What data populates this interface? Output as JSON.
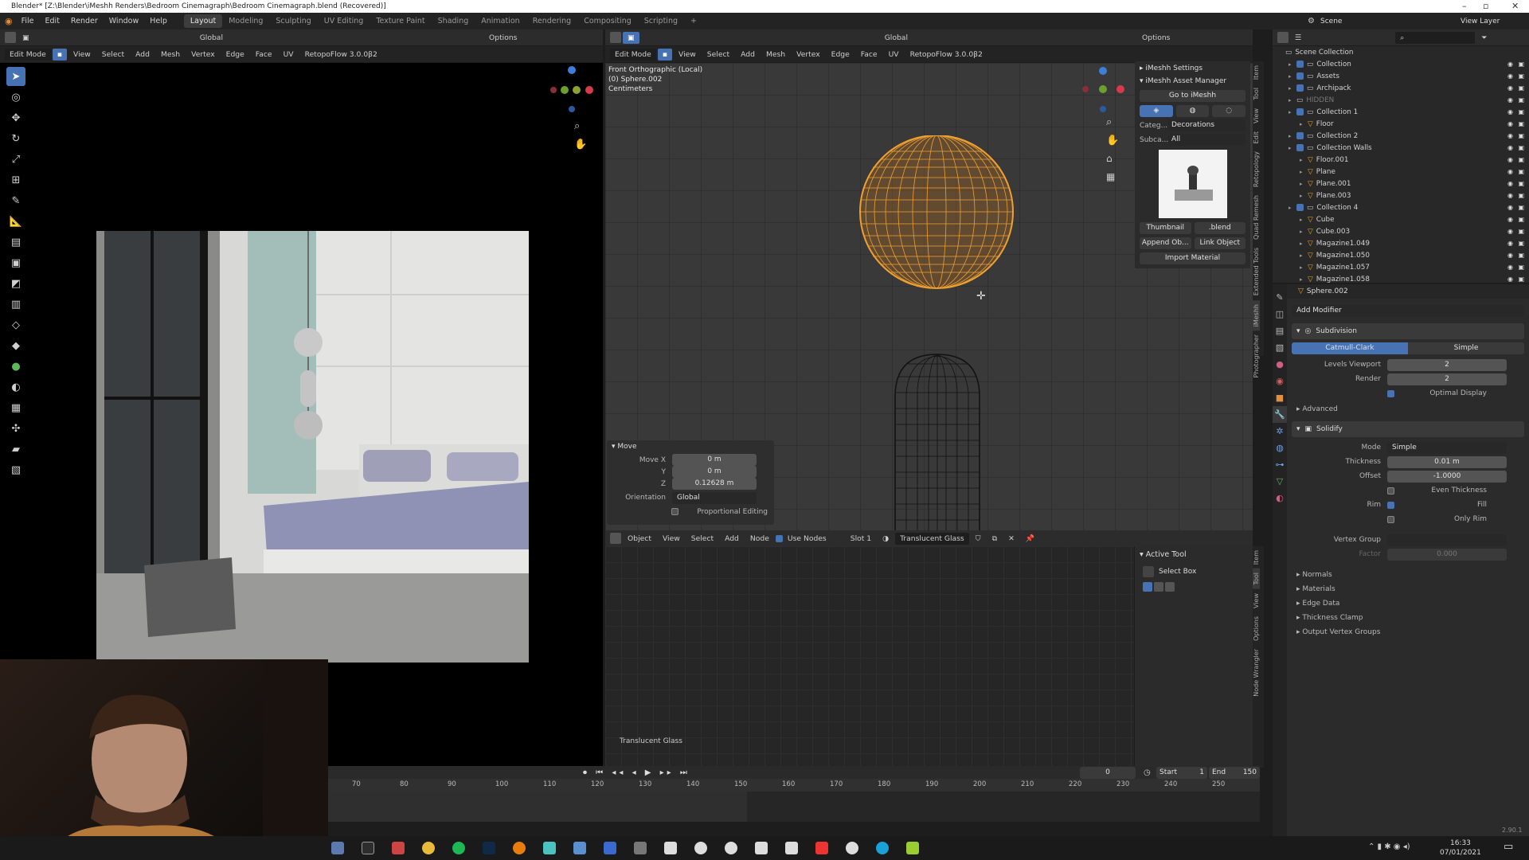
{
  "window": {
    "title": "Blender* [Z:\\Blender\\iMeshh Renders\\Bedroom Cinemagraph\\Bedroom Cinemagraph.blend (Recovered)]"
  },
  "menu": [
    "File",
    "Edit",
    "Render",
    "Window",
    "Help"
  ],
  "workspaces": [
    "Layout",
    "Modeling",
    "Sculpting",
    "UV Editing",
    "Texture Paint",
    "Shading",
    "Animation",
    "Rendering",
    "Compositing",
    "Scripting",
    "+"
  ],
  "scene": {
    "label": "Scene",
    "view_layer": "View Layer"
  },
  "left_view": {
    "header1": {
      "orientation": "Global",
      "options": "Options"
    },
    "header2": {
      "mode": "Edit Mode",
      "menus": [
        "View",
        "Select",
        "Add",
        "Mesh",
        "Vertex",
        "Edge",
        "Face",
        "UV"
      ],
      "retopo": "RetopoFlow 3.0.0β2"
    }
  },
  "main_view": {
    "header1": {
      "mode": "Edit Mode",
      "menus": [
        "View",
        "Select",
        "Add",
        "Mesh",
        "Vertex",
        "Edge",
        "Face",
        "UV"
      ],
      "retopo": "RetopoFlow 3.0.0β2",
      "orientation": "Global",
      "options": "Options"
    },
    "overlay_lines": [
      "Front Orthographic (Local)",
      "(0) Sphere.002",
      "Centimeters"
    ],
    "move_panel": {
      "title": "Move",
      "fields": [
        {
          "label": "Move X",
          "value": "0 m"
        },
        {
          "label": "Y",
          "value": "0 m"
        },
        {
          "label": "Z",
          "value": "0.12628 m"
        }
      ],
      "orientation_label": "Orientation",
      "orientation_value": "Global",
      "proportional": "Proportional Editing"
    }
  },
  "imeshh": {
    "settings": "iMeshh Settings",
    "asset_manager": "iMeshh Asset Manager",
    "goto": "Go to iMeshh",
    "category_label": "Categ...",
    "category_value": "Decorations",
    "subcat_label": "Subca...",
    "subcat_value": "All",
    "thumbnail": "Thumbnail",
    "blend": ".blend",
    "append": "Append Ob...",
    "link": "Link Object",
    "import_material": "Import Material",
    "side_tabs": [
      "Item",
      "Tool",
      "View",
      "Edit",
      "Retopology",
      "Quad Remesh",
      "Extended Tools",
      "iMeshh",
      "Photographer"
    ]
  },
  "node_editor": {
    "header": {
      "type": "Object",
      "menus": [
        "View",
        "Select",
        "Add",
        "Node"
      ],
      "use_nodes": "Use Nodes",
      "slot": "Slot 1",
      "material": "Translucent Glass"
    },
    "label": "Translucent Glass",
    "active_tool": {
      "title": "Active Tool",
      "tool": "Select Box"
    },
    "side_tabs": [
      "Item",
      "Tool",
      "View",
      "Options",
      "Node Wrangler"
    ]
  },
  "outliner": {
    "items": [
      {
        "name": "Scene Collection",
        "depth": 0,
        "checkbox": false
      },
      {
        "name": "Collection",
        "depth": 1,
        "checkbox": true
      },
      {
        "name": "Assets",
        "depth": 1,
        "checkbox": true
      },
      {
        "name": "Archipack",
        "depth": 1,
        "checkbox": true
      },
      {
        "name": "HIDDEN",
        "depth": 1,
        "checkbox": false
      },
      {
        "name": "Collection 1",
        "depth": 1,
        "checkbox": true
      },
      {
        "name": "Floor",
        "depth": 2,
        "checkbox": false
      },
      {
        "name": "Collection 2",
        "depth": 1,
        "checkbox": true
      },
      {
        "name": "Collection Walls",
        "depth": 1,
        "checkbox": true
      },
      {
        "name": "Floor.001",
        "depth": 2,
        "checkbox": false
      },
      {
        "name": "Plane",
        "depth": 2,
        "checkbox": false
      },
      {
        "name": "Plane.001",
        "depth": 2,
        "checkbox": false
      },
      {
        "name": "Plane.003",
        "depth": 2,
        "checkbox": false
      },
      {
        "name": "Collection 4",
        "depth": 1,
        "checkbox": true
      },
      {
        "name": "Cube",
        "depth": 2,
        "checkbox": false
      },
      {
        "name": "Cube.003",
        "depth": 2,
        "checkbox": false
      },
      {
        "name": "Magazine1.049",
        "depth": 2,
        "checkbox": false
      },
      {
        "name": "Magazine1.050",
        "depth": 2,
        "checkbox": false
      },
      {
        "name": "Magazine1.057",
        "depth": 2,
        "checkbox": false
      },
      {
        "name": "Magazine1.058",
        "depth": 2,
        "checkbox": false
      }
    ]
  },
  "properties": {
    "object": "Sphere.002",
    "add_modifier": "Add Modifier",
    "subdivision": {
      "name": "Subdivision",
      "tab_a": "Catmull-Clark",
      "tab_b": "Simple",
      "levels_label": "Levels Viewport",
      "levels_value": "2",
      "render_label": "Render",
      "render_value": "2",
      "optimal": "Optimal Display",
      "advanced": "Advanced"
    },
    "solidify": {
      "name": "Solidify",
      "mode_label": "Mode",
      "mode_value": "Simple",
      "thickness_label": "Thickness",
      "thickness_value": "0.01 m",
      "offset_label": "Offset",
      "offset_value": "-1.0000",
      "even": "Even Thickness",
      "rim_label": "Rim",
      "fill": "Fill",
      "only_rim": "Only Rim",
      "vgroup_label": "Vertex Group",
      "factor_label": "Factor",
      "factor_value": "0.000",
      "sections": [
        "Normals",
        "Materials",
        "Edge Data",
        "Thickness Clamp",
        "Output Vertex Groups"
      ]
    }
  },
  "timeline": {
    "current": "0",
    "start_label": "Start",
    "start": "1",
    "end_label": "End",
    "end": "150",
    "ticks": [
      "70",
      "80",
      "90",
      "100",
      "110",
      "120",
      "130",
      "140",
      "150",
      "160",
      "170",
      "180",
      "190",
      "200",
      "210",
      "220",
      "230",
      "240",
      "250"
    ]
  },
  "version": "2.90.1",
  "taskbar": {
    "time": "16:33",
    "date": "07/01/2021"
  },
  "colors": {
    "accent": "#4772b3",
    "selection": "#f0a030",
    "bg": "#393939"
  }
}
